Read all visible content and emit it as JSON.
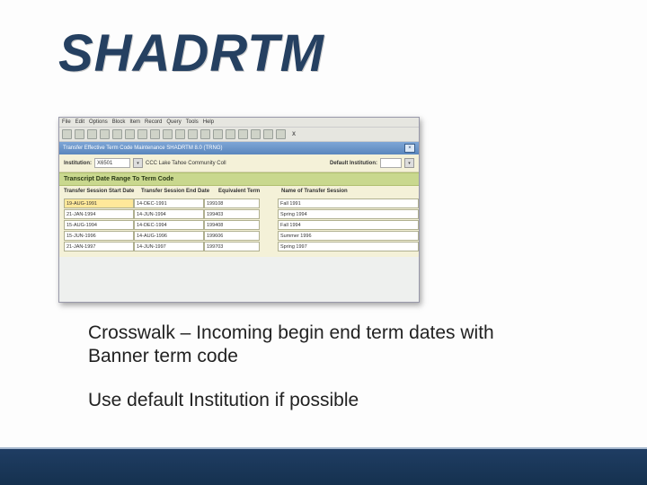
{
  "title": "SHADRTM",
  "screenshot": {
    "menu": [
      "File",
      "Edit",
      "Options",
      "Block",
      "Item",
      "Record",
      "Query",
      "Tools",
      "Help"
    ],
    "toolbar_x": "X",
    "window_title": "Transfer Effective Term Code Maintenance SHADRTM 8.0 (TRNG)",
    "institution_label": "Institution:",
    "institution_value": "X6501",
    "institution_desc": "CCC Lake Tahoe Community Coll",
    "default_institution_label": "Default Institution:",
    "default_institution_value": "",
    "section_title": "Transcript Date Range To Term Code",
    "headers": {
      "c1": "Transfer Session Start Date",
      "c2": "Transfer Session End Date",
      "c3": "Equivalent Term",
      "c4": "Name of Transfer Session"
    },
    "rows": [
      {
        "start": "19-AUG-1991",
        "end": "14-DEC-1991",
        "term": "199108",
        "name": "Fall 1991"
      },
      {
        "start": "21-JAN-1994",
        "end": "14-JUN-1994",
        "term": "199403",
        "name": "Spring 1994"
      },
      {
        "start": "15-AUG-1994",
        "end": "14-DEC-1994",
        "term": "199408",
        "name": "Fall 1994"
      },
      {
        "start": "15-JUN-1996",
        "end": "14-AUG-1996",
        "term": "199606",
        "name": "Summer 1996"
      },
      {
        "start": "21-JAN-1997",
        "end": "14-JUN-1997",
        "term": "199703",
        "name": "Spring 1997"
      }
    ]
  },
  "body": {
    "p1": "Crosswalk – Incoming begin end term dates with Banner term code",
    "p2": "Use default Institution if possible"
  }
}
